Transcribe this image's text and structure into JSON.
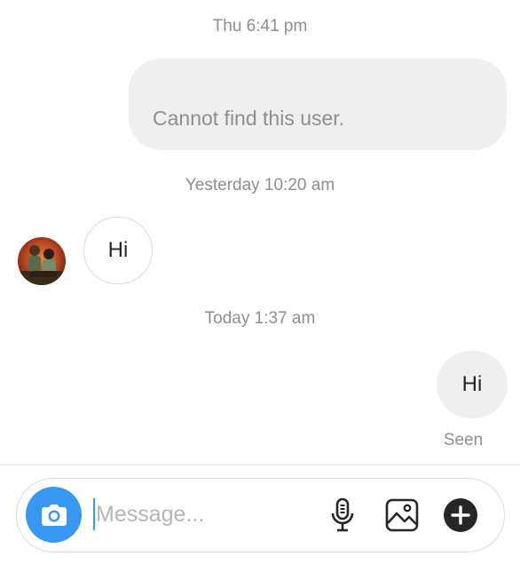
{
  "conversation": {
    "messages": [
      {
        "timestamp": "Thu 6:41 pm",
        "sender": "me",
        "text": "Cannot find this user."
      },
      {
        "timestamp": "Yesterday 10:20 am",
        "sender": "them",
        "text": "Hi"
      },
      {
        "timestamp": "Today 1:37 am",
        "sender": "me",
        "text": "Hi",
        "status": "Seen"
      }
    ]
  },
  "composer": {
    "placeholder": "Message...",
    "value": "",
    "icons": {
      "camera": "camera-icon",
      "mic": "microphone-icon",
      "gallery": "image-gallery-icon",
      "more": "plus-circle-icon"
    }
  },
  "colors": {
    "accent": "#3897f0",
    "outgoing_bubble": "#efefef",
    "muted_text": "#8e8e8e"
  }
}
